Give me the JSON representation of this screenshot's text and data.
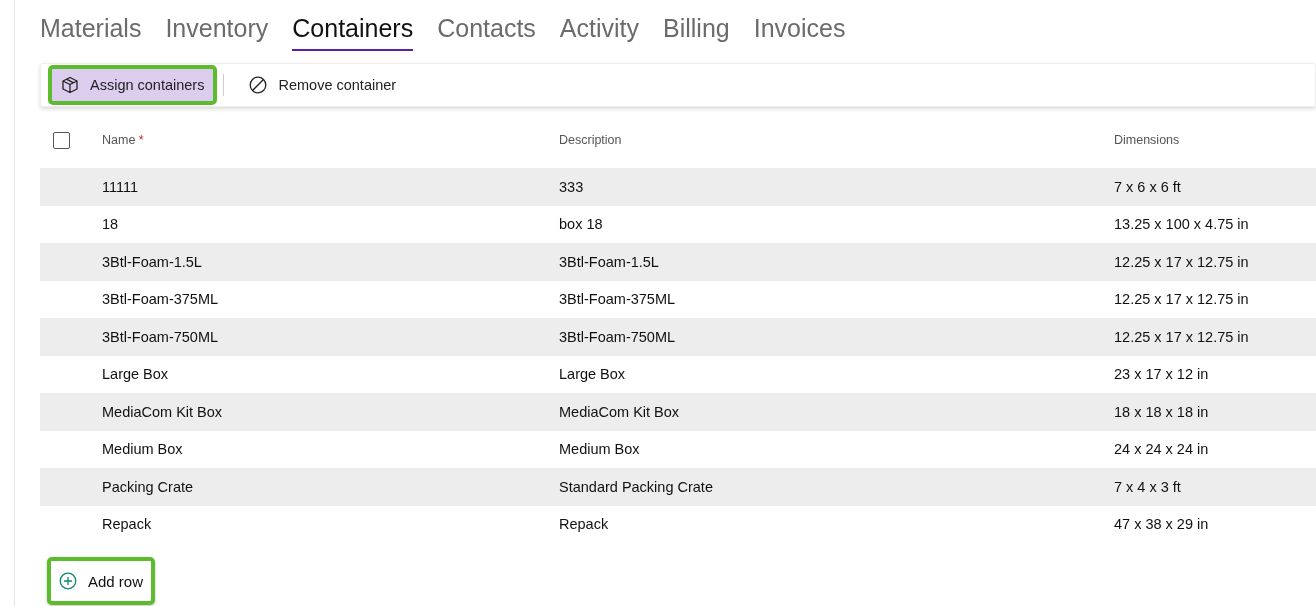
{
  "tabs": [
    {
      "label": "Materials",
      "selected": false
    },
    {
      "label": "Inventory",
      "selected": false
    },
    {
      "label": "Containers",
      "selected": true
    },
    {
      "label": "Contacts",
      "selected": false
    },
    {
      "label": "Activity",
      "selected": false
    },
    {
      "label": "Billing",
      "selected": false
    },
    {
      "label": "Invoices",
      "selected": false
    }
  ],
  "toolbar": [
    {
      "kind": "assign",
      "label": "Assign containers",
      "highlighted": true
    },
    {
      "kind": "remove",
      "label": "Remove container",
      "highlighted": false
    }
  ],
  "table": {
    "select_all": {
      "checked": false
    },
    "columns": [
      {
        "label": "Name",
        "required_mark": "*"
      },
      {
        "label": "Description"
      },
      {
        "label": "Dimensions"
      }
    ],
    "rows": [
      [
        "11111",
        "333",
        "7 x 6 x 6 ft"
      ],
      [
        "18",
        "box 18",
        "13.25 x 100 x 4.75 in"
      ],
      [
        "3Btl-Foam-1.5L",
        "3Btl-Foam-1.5L",
        "12.25 x 17 x 12.75 in"
      ],
      [
        "3Btl-Foam-375ML",
        "3Btl-Foam-375ML",
        "12.25 x 17 x 12.75 in"
      ],
      [
        "3Btl-Foam-750ML",
        "3Btl-Foam-750ML",
        "12.25 x 17 x 12.75 in"
      ],
      [
        "Large Box",
        "Large Box",
        "23 x 17 x 12 in"
      ],
      [
        "MediaCom Kit Box",
        "MediaCom Kit Box",
        "18 x 18 x 18 in"
      ],
      [
        "Medium Box",
        "Medium Box",
        "24 x 24 x 24 in"
      ],
      [
        "Packing Crate",
        "Standard Packing Crate",
        "7 x 4 x 3 ft"
      ],
      [
        "Repack",
        "Repack",
        "47 x 38 x 29 in"
      ]
    ]
  },
  "add_row": {
    "label": "Add row",
    "highlighted": true
  }
}
